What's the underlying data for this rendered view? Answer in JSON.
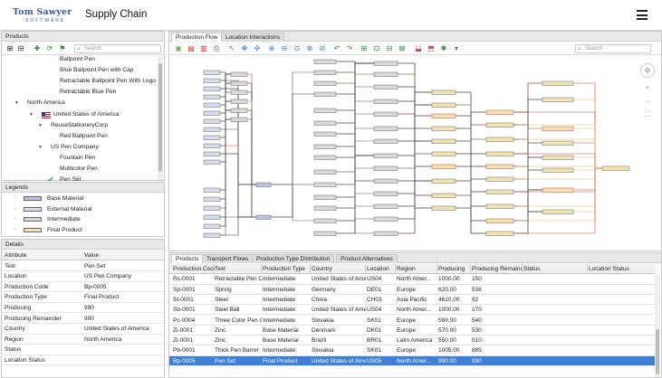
{
  "header": {
    "logo_main": "Tom Sawyer",
    "logo_sub": "SOFTWARE",
    "title": "Supply Chain"
  },
  "products_panel": {
    "title": "Products",
    "search_placeholder": "Search",
    "tree": [
      {
        "label": "Ballpoint Pen",
        "indent": 64,
        "icon": "none",
        "expand": ""
      },
      {
        "label": "Blue Ballpoint Pen with Cap",
        "indent": 64,
        "icon": "none",
        "expand": ""
      },
      {
        "label": "Retractable Ballpoint Pen With Logo",
        "indent": 64,
        "icon": "none",
        "expand": ""
      },
      {
        "label": "Retractable Blue Pen",
        "indent": 64,
        "icon": "none",
        "expand": ""
      },
      {
        "label": "North America",
        "indent": 28,
        "icon": "none",
        "expand": "▼"
      },
      {
        "label": "United States of America",
        "indent": 44,
        "icon": "flag",
        "expand": "▼"
      },
      {
        "label": "ReuseStationeryCorp",
        "indent": 54,
        "icon": "none",
        "expand": "▼"
      },
      {
        "label": "Red Ballpoint Pen",
        "indent": 64,
        "icon": "none",
        "expand": ""
      },
      {
        "label": "US Pen Company",
        "indent": 54,
        "icon": "none",
        "expand": "▼"
      },
      {
        "label": "Fountain Pen",
        "indent": 64,
        "icon": "none",
        "expand": ""
      },
      {
        "label": "Multicolor Pen",
        "indent": 64,
        "icon": "none",
        "expand": ""
      },
      {
        "label": "Pen Set",
        "indent": 64,
        "icon": "check",
        "expand": ""
      }
    ]
  },
  "legends_panel": {
    "title": "Legends",
    "items": [
      {
        "label": "Base Material",
        "color": "#b9c3e6"
      },
      {
        "label": "External Material",
        "color": "#d6dcef"
      },
      {
        "label": "Intermediate",
        "color": "#d9d9d9"
      },
      {
        "label": "Final Product",
        "color": "#f1e3b4"
      }
    ]
  },
  "details_panel": {
    "title": "Details",
    "headers": [
      "Attribute",
      "Value"
    ],
    "rows": [
      {
        "attr": "Text",
        "value": "Pen Set"
      },
      {
        "attr": "Location",
        "value": "US Pen Company"
      },
      {
        "attr": "Production Code",
        "value": "Bp-0005"
      },
      {
        "attr": "Production Type",
        "value": "Final Product"
      },
      {
        "attr": "Producing",
        "value": "990"
      },
      {
        "attr": "Producing Remainder",
        "value": "990"
      },
      {
        "attr": "Country",
        "value": "United States of America"
      },
      {
        "attr": "Region",
        "value": "North America"
      },
      {
        "attr": "Status",
        "value": "",
        "icon": "error-icon"
      },
      {
        "attr": "Location Status",
        "value": "",
        "icon": "ok-icon"
      }
    ]
  },
  "diagram": {
    "tabs": [
      {
        "label": "Production Flow",
        "active": true
      },
      {
        "label": "Location Interactions",
        "active": false
      }
    ],
    "search_placeholder": "Search"
  },
  "grid": {
    "tabs": [
      {
        "label": "Products",
        "active": true
      },
      {
        "label": "Transport Flows",
        "active": false
      },
      {
        "label": "Production Type Distribution",
        "active": false
      },
      {
        "label": "Product Alternatives",
        "active": false
      }
    ],
    "columns": [
      "Production Code",
      "Text",
      "Production Type",
      "Country",
      "Location",
      "Region",
      "Producing",
      "Producing Remainder",
      "Status",
      "Location Status"
    ],
    "rows": [
      {
        "code": "Rc-0001",
        "text": "Retractable Pen Core",
        "type": "Intermediate",
        "country": "United States of Ameri",
        "location": "US04",
        "region": "North Amer...",
        "producing": "1000.00",
        "remainder": "150",
        "status": "warn",
        "loc_status": "ok",
        "selected": false
      },
      {
        "code": "Sp-0001",
        "text": "Spring",
        "type": "Intermediate",
        "country": "Germany",
        "location": "DE01",
        "region": "Europe",
        "producing": "620.00",
        "remainder": "536",
        "status": "warn",
        "loc_status": "ok",
        "selected": false
      },
      {
        "code": "St-0001",
        "text": "Steel",
        "type": "Intermediate",
        "country": "China",
        "location": "CH03",
        "region": "Asia Pacific",
        "producing": "4610.00",
        "remainder": "92",
        "status": "warn",
        "loc_status": "ok",
        "selected": false
      },
      {
        "code": "Sb-0001",
        "text": "Steel Ball",
        "type": "Intermediate",
        "country": "United States of Ameri",
        "location": "US04",
        "region": "North Amer...",
        "producing": "1000.00",
        "remainder": "170",
        "status": "warn",
        "loc_status": "ok",
        "selected": false
      },
      {
        "code": "Pc-0004",
        "text": "Three Color Pen Core",
        "type": "Intermediate",
        "country": "Slovakia",
        "location": "SK01",
        "region": "Europe",
        "producing": "580.00",
        "remainder": "540",
        "status": "",
        "loc_status": "ok",
        "selected": false
      },
      {
        "code": "Zi-0001",
        "text": "Zinc",
        "type": "Base Material",
        "country": "Denmark",
        "location": "DK01",
        "region": "Europe",
        "producing": "570.00",
        "remainder": "530",
        "status": "",
        "loc_status": "ok",
        "selected": false
      },
      {
        "code": "Zi-0001",
        "text": "Zinc",
        "type": "Base Material",
        "country": "Brazil",
        "location": "BR01",
        "region": "Latin America",
        "producing": "550.00",
        "remainder": "510",
        "status": "",
        "loc_status": "ok",
        "selected": false
      },
      {
        "code": "Pb-0001",
        "text": "Thick Pen Barrel",
        "type": "Intermediate",
        "country": "Slovakia",
        "location": "SK01",
        "region": "Europe",
        "producing": "1005.00",
        "remainder": "885",
        "status": "",
        "loc_status": "ok",
        "selected": false
      },
      {
        "code": "Bp-0005",
        "text": "Pen Set",
        "type": "Final Product",
        "country": "United States of Ameri",
        "location": "US05",
        "region": "North Amer...",
        "producing": "990.00",
        "remainder": "990",
        "status": "error",
        "loc_status": "ok",
        "selected": true
      }
    ]
  }
}
